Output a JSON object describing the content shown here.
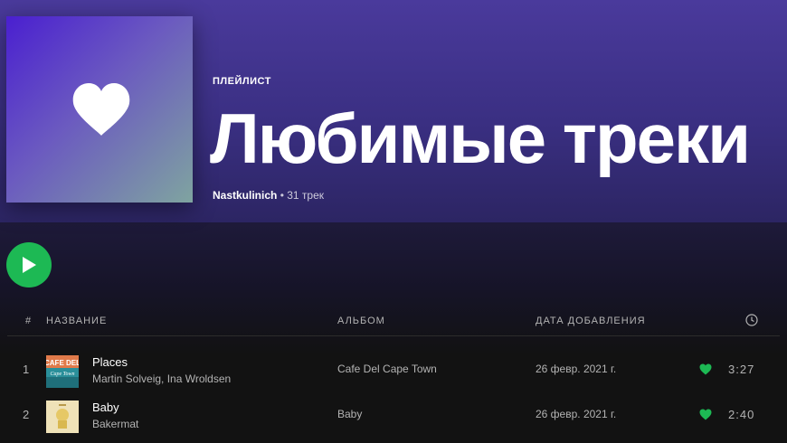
{
  "playlist": {
    "type_label": "ПЛЕЙЛИСТ",
    "title": "Любимые треки",
    "owner": "Nastkulinich",
    "separator": "•",
    "track_count": "31 трек",
    "cover_icon": "heart-icon"
  },
  "controls": {
    "play_icon": "play-icon"
  },
  "columns": {
    "number": "#",
    "title": "НАЗВАНИЕ",
    "album": "АЛЬБОМ",
    "date_added": "ДАТА ДОБАВЛЕНИЯ",
    "duration_icon": "clock-icon"
  },
  "tracks": [
    {
      "number": "1",
      "title": "Places",
      "artist": "Martin Solveig, Ina Wroldsen",
      "album": "Cafe Del Cape Town",
      "date_added": "26 февр. 2021 г.",
      "duration": "3:27",
      "liked": true,
      "art_text": "CAFE DEL",
      "art_subtext": "Cape Town"
    },
    {
      "number": "2",
      "title": "Baby",
      "artist": "Bakermat",
      "album": "Baby",
      "date_added": "26 февр. 2021 г.",
      "duration": "2:40",
      "liked": true
    }
  ],
  "colors": {
    "accent_green": "#1db954",
    "header_purple": "#3a2f82",
    "background": "#121212"
  }
}
